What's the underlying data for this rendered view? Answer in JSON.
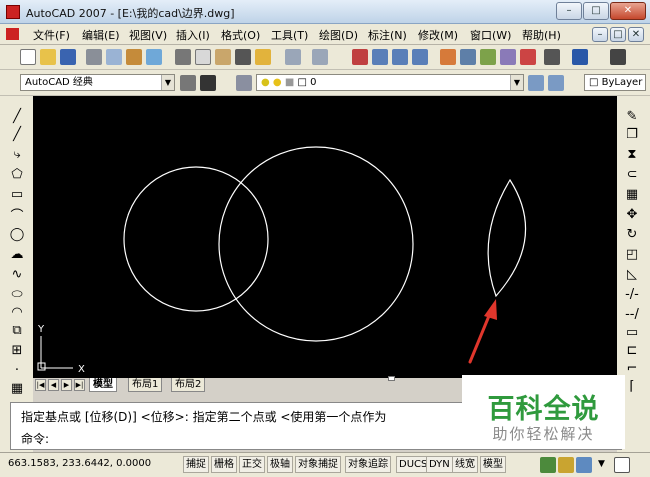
{
  "window": {
    "title": "AutoCAD 2007 - [E:\\我的cad\\边界.dwg]",
    "controls": [
      "–",
      "□",
      "✕"
    ]
  },
  "menu": {
    "items": [
      "文件(F)",
      "编辑(E)",
      "视图(V)",
      "插入(I)",
      "格式(O)",
      "工具(T)",
      "绘图(D)",
      "标注(N)",
      "修改(M)",
      "窗口(W)",
      "帮助(H)"
    ],
    "doc_controls": [
      "–",
      "□",
      "✕"
    ]
  },
  "toolbar2": {
    "workspace": "AutoCAD 经典",
    "layer": "0",
    "linetype": "ByLayer"
  },
  "layout_tabs": [
    "模型",
    "布局1",
    "布局2"
  ],
  "command": {
    "history": "指定基点或 [位移(D)] <位移>:  指定第二个点或 <使用第一个点作为",
    "prompt": "命令:"
  },
  "status": {
    "coords": "663.1583,  233.6442, 0.0000",
    "buttons": [
      "捕捉",
      "栅格",
      "正交",
      "极轴",
      "对象捕捉",
      "对象追踪",
      "DUCS",
      "DYN",
      "线宽",
      "模型"
    ]
  },
  "ucs": {
    "x_label": "X",
    "y_label": "Y"
  },
  "watermark": {
    "title": "百科全说",
    "subtitle": "助你轻松解决"
  },
  "colors": {
    "canvas": "#000000",
    "arrow": "#e0362c",
    "watermark_green": "#2f9a3d"
  }
}
